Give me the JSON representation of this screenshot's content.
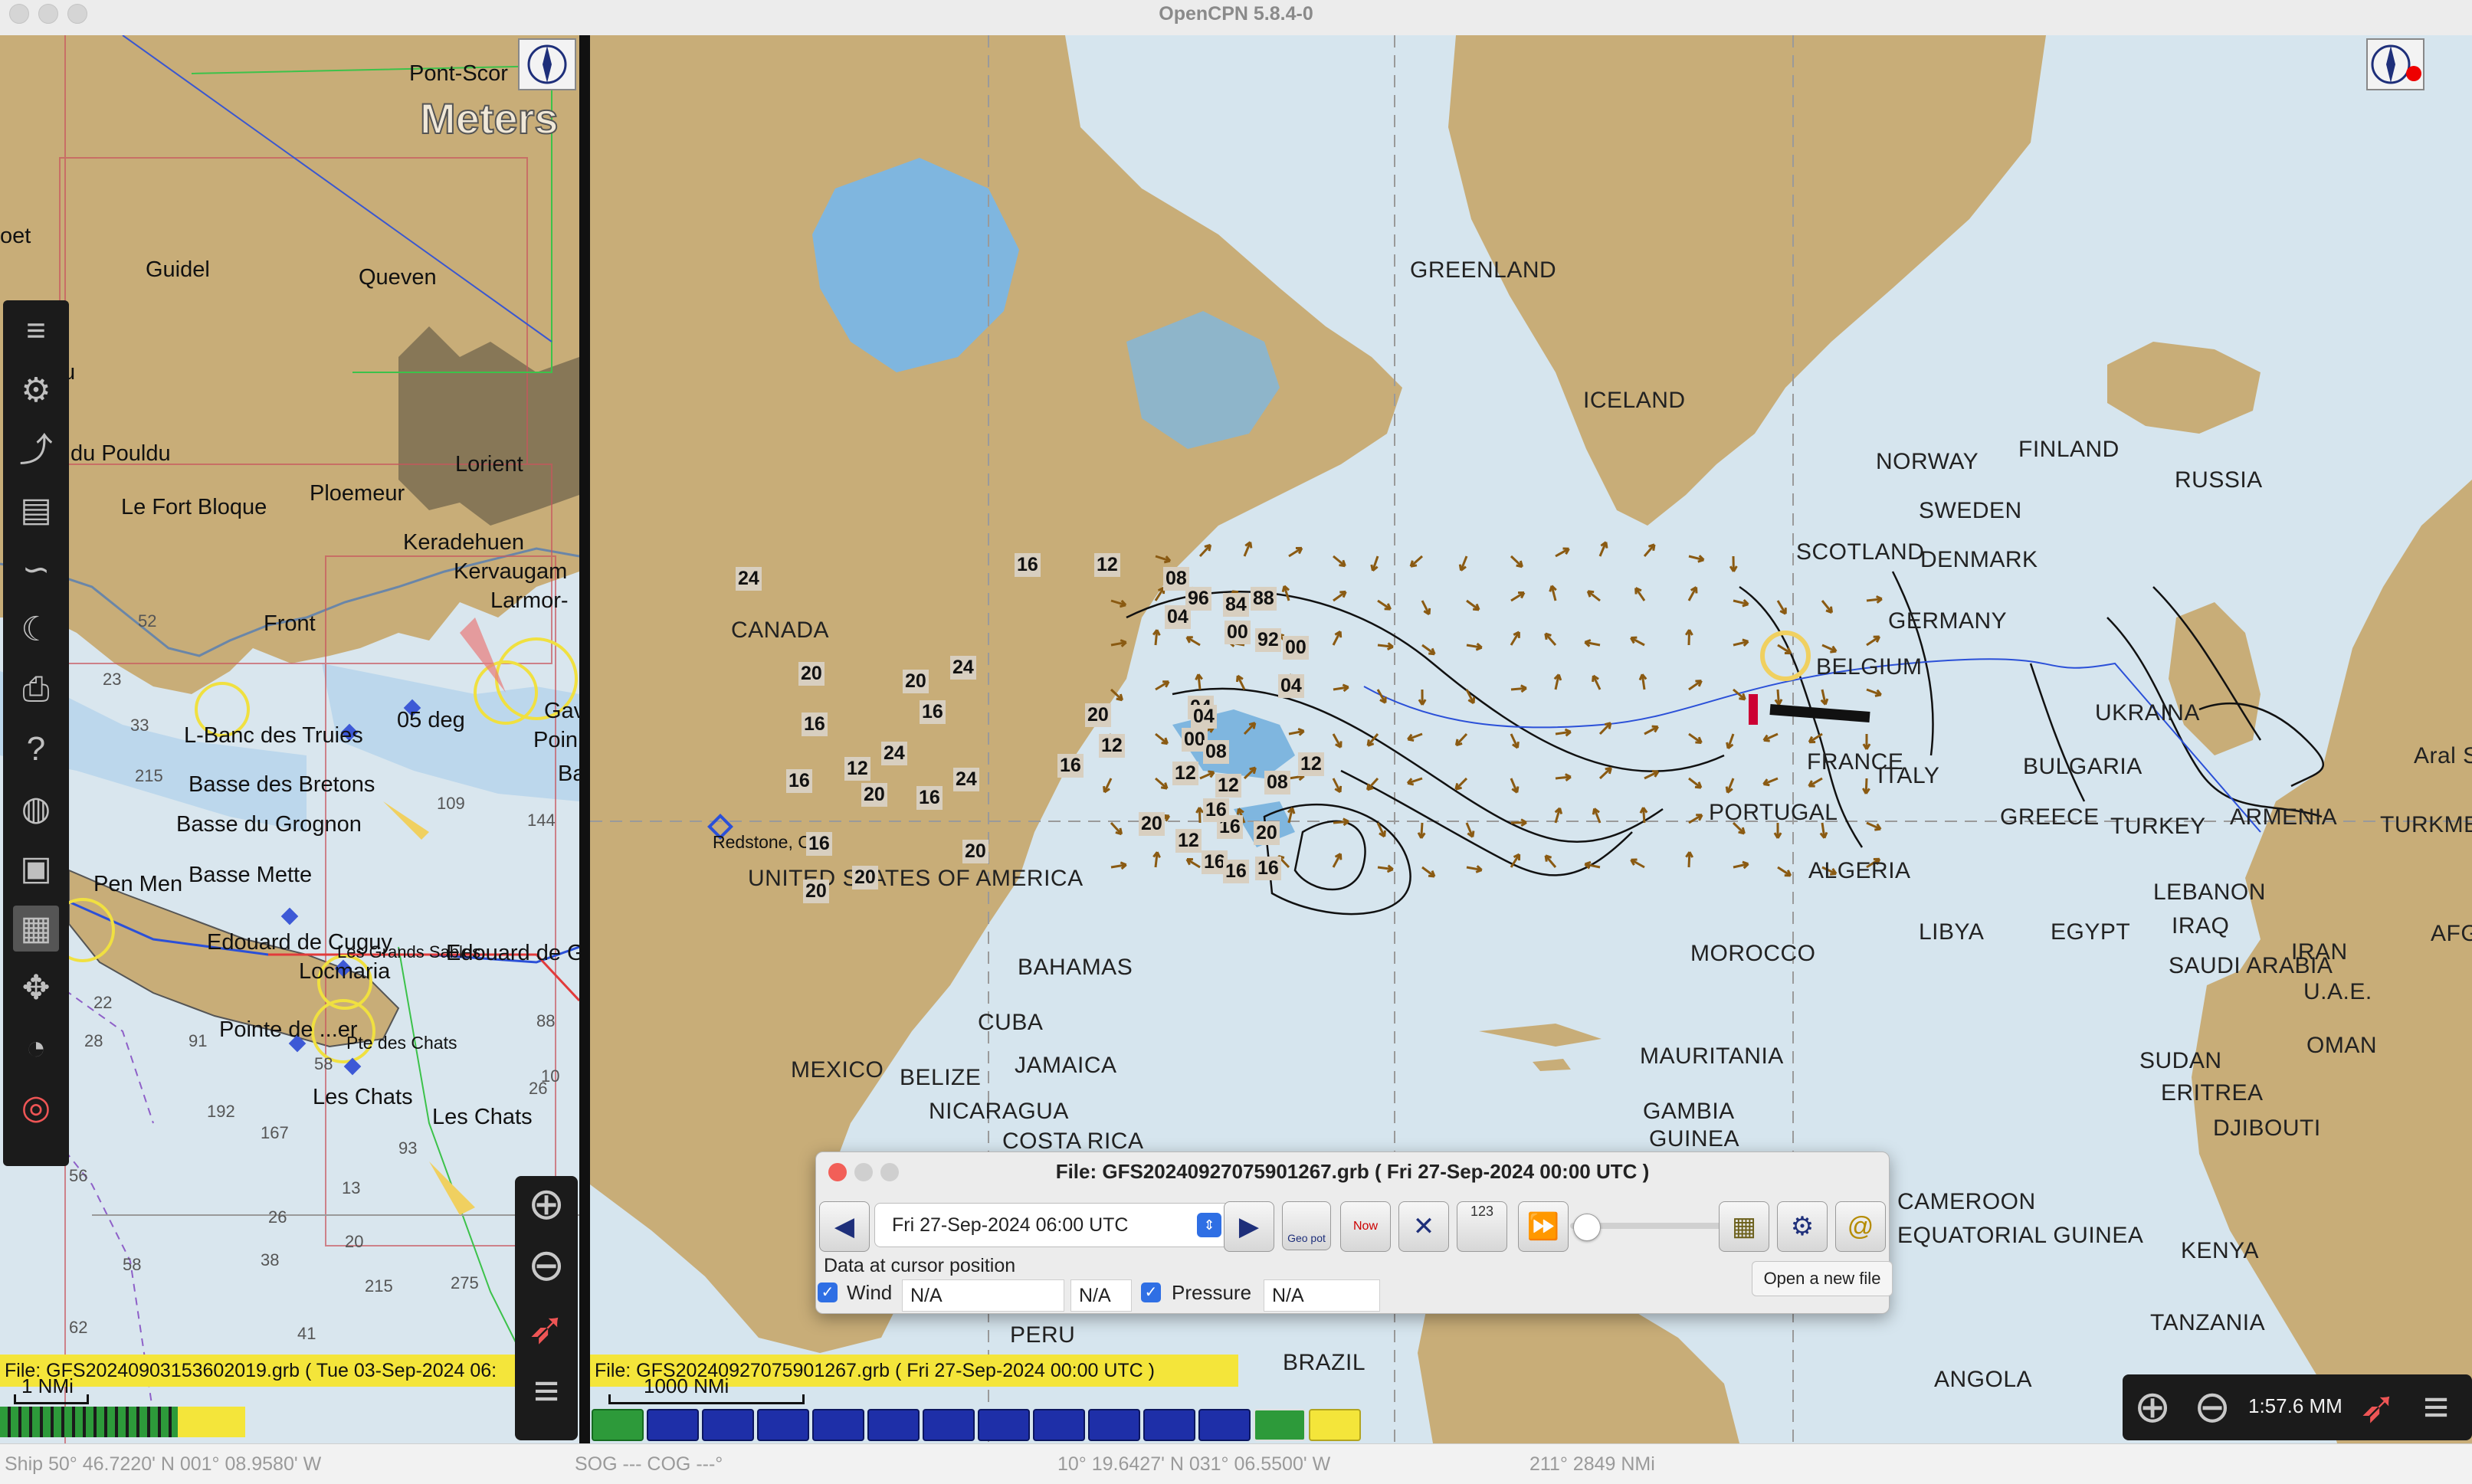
{
  "window": {
    "title": "OpenCPN 5.8.4-0"
  },
  "left_chart": {
    "overlay_text": "Meters",
    "places": [
      "Pont-Scor",
      "Guidel",
      "Queven",
      "du Pouldu",
      "Lorient",
      "Le Fort Bloque",
      "Ploemeur",
      "Keradehuen",
      "Kervaugam",
      "Larmor-",
      "Front",
      "L-Banc des Truies",
      "Basse des Bretons",
      "Basse du Grognon",
      "Basse Mette",
      "Pen Men",
      "Edouard de Cuguy",
      "Locmaria",
      "Edouard de G",
      "Pointe de ...er",
      "Pte des Chats",
      "Les Chats",
      "Les Chats",
      "oet",
      "u",
      "05 deg",
      "Gav",
      "Poin",
      "Ba",
      "Les Grands Sables"
    ],
    "depths": [
      "52",
      "23",
      "33",
      "215",
      "22",
      "28",
      "91",
      "58",
      "192",
      "167",
      "56",
      "26",
      "58",
      "38",
      "62",
      "41",
      "20",
      "215",
      "275",
      "144",
      "109",
      "10",
      "88",
      "26",
      "13",
      "93"
    ],
    "status": "File: GFS20240903153602019.grb ( Tue 03-Sep-2024 06:",
    "scale": "1 NMi"
  },
  "right_chart": {
    "countries": [
      "GREENLAND",
      "ICELAND",
      "CANADA",
      "UNITED STATES OF AMERICA",
      "BAHAMAS",
      "MEXICO",
      "CUBA",
      "JAMAICA",
      "BELIZE",
      "NICARAGUA",
      "COSTA RICA",
      "PERU",
      "BRAZIL",
      "NORWAY",
      "FINLAND",
      "RUSSIA",
      "SWEDEN",
      "SCOTLAND",
      "DENMARK",
      "GERMANY",
      "BELGIUM",
      "FRANCE",
      "UKRAINA",
      "BULGARIA",
      "GREECE",
      "TURKEY",
      "ARMENIA",
      "TURKMEN",
      "Aral Se",
      "PORTUGAL",
      "ALGERIA",
      "MOROCCO",
      "LIBYA",
      "EGYPT",
      "LEBANON",
      "IRAQ",
      "IRAN",
      "SAUDI ARABIA",
      "U.A.E.",
      "OMAN",
      "AFG",
      "MAURITANIA",
      "GAMBIA",
      "GUINEA",
      "SUDAN",
      "ERITREA",
      "DJIBOUTI",
      "CAMEROON",
      "EQUATORIAL GUINEA",
      "KENYA",
      "TANZANIA",
      "ANGOLA",
      "ITALY"
    ],
    "marker_label": "Redstone, CO.",
    "status": "File: GFS20240927075901267.grb ( Fri 27-Sep-2024 00:00  UTC )",
    "scale": "1000 NMi",
    "zoom_text": "1:57.6 MM",
    "isobar_labels": [
      "20",
      "24",
      "20",
      "16",
      "16",
      "20",
      "24",
      "20",
      "16",
      "12",
      "16",
      "16",
      "20",
      "20",
      "24",
      "20",
      "16",
      "24",
      "20",
      "16",
      "24",
      "20",
      "12",
      "16",
      "16",
      "12",
      "08",
      "04",
      "96",
      "84",
      "88",
      "92",
      "00",
      "00",
      "04",
      "04",
      "00",
      "08",
      "12",
      "12",
      "08",
      "12",
      "16",
      "16",
      "12",
      "20",
      "20",
      "16",
      "20",
      "16",
      "04",
      "16"
    ]
  },
  "grib_dialog": {
    "title": "File: GFS20240927075901267.grb ( Fri 27-Sep-2024 00:00  UTC )",
    "time_value": "Fri 27-Sep-2024 06:00  UTC",
    "cursor_label": "Data at cursor position",
    "wind_label": "Wind",
    "wind_value1": "N/A",
    "wind_value2": "N/A",
    "pressure_label": "Pressure",
    "pressure_value": "N/A",
    "tooltip": "Open a new file",
    "btn_geopot": "Geo pot",
    "btn_now": "Now",
    "btn_123": "123"
  },
  "statusbar": {
    "ship": "Ship 50° 46.7220' N   001° 08.9580' W",
    "sog": "SOG --- COG ---°",
    "cursor": "10° 19.6427' N   031° 06.5500' W",
    "bearing": "211°   2849 NMi"
  },
  "colors": {
    "land": "#c8ad78",
    "sea": "#d6e5ee",
    "shallow": "#7fb6df",
    "status_yellow": "#f4e53a",
    "piano_blue": "#1e2fa8",
    "piano_green": "#2d9a3a"
  },
  "icons": [
    "menu-icon",
    "settings-icon",
    "route-icon",
    "document-icon",
    "track-icon",
    "tide-icon",
    "print-icon",
    "help-icon",
    "globe-icon",
    "grib-icon",
    "chart-icon",
    "compass-icon",
    "dashboard-icon",
    "lifering-icon",
    "zoom-in-icon",
    "zoom-out-icon",
    "north-arrow-icon"
  ]
}
